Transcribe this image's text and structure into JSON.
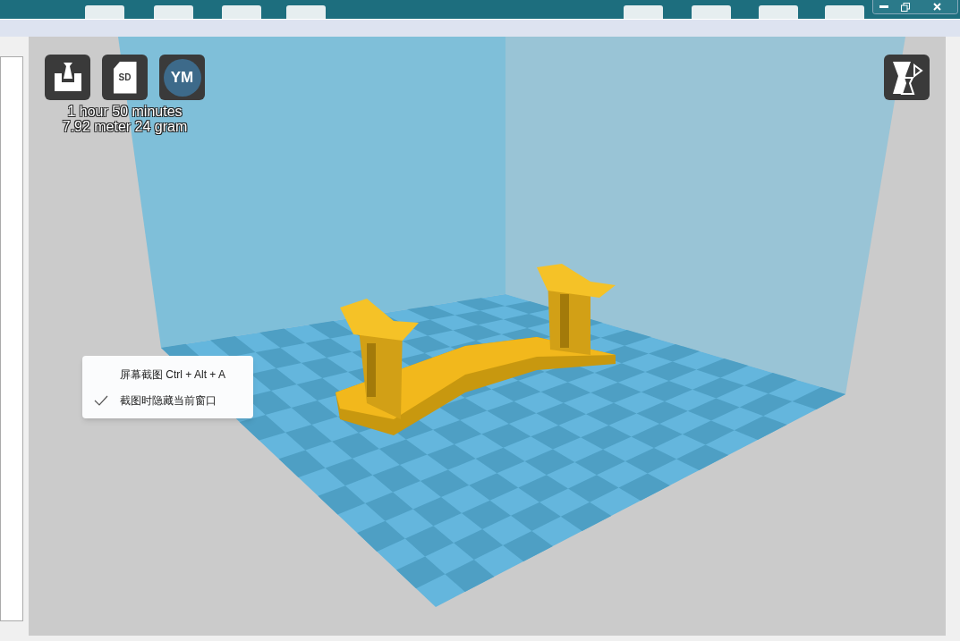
{
  "toolbar": {
    "buttons": [
      {
        "kind": "load"
      },
      {
        "kind": "sd",
        "label": "SD"
      },
      {
        "kind": "ym",
        "label": "YM"
      }
    ]
  },
  "print_info": {
    "time": "1 hour 50 minutes",
    "material": "7.92 meter 24 gram"
  },
  "context_menu": {
    "items": [
      {
        "label": "屏幕截图 Ctrl + Alt + A",
        "checked": false
      },
      {
        "label": "截图时隐藏当前窗口",
        "checked": true
      }
    ]
  }
}
